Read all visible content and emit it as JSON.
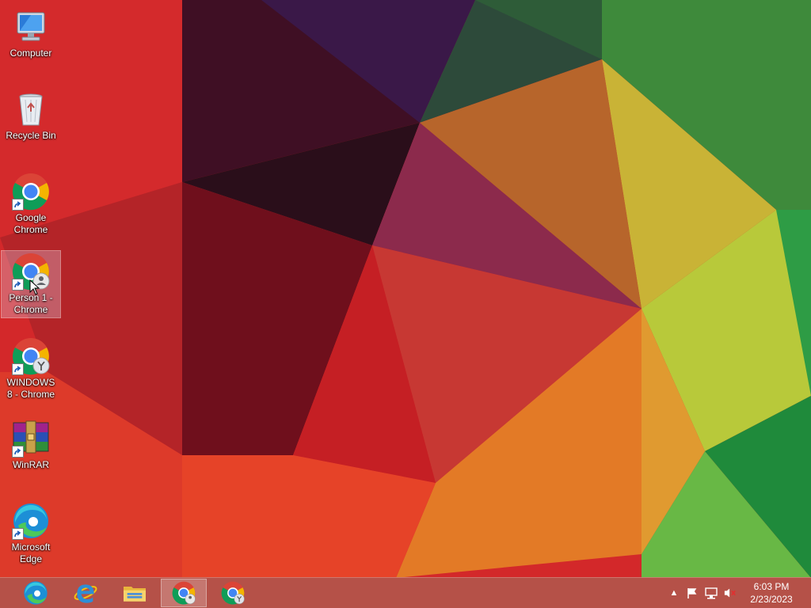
{
  "desktop": {
    "icons": [
      {
        "label": "Computer",
        "icon": "computer-icon"
      },
      {
        "label": "Recycle Bin",
        "icon": "recycle-bin-icon"
      },
      {
        "label": "Google Chrome",
        "icon": "chrome-icon"
      },
      {
        "label": "Person 1 - Chrome",
        "icon": "chrome-profile-icon",
        "selected": true
      },
      {
        "label": "WINDOWS 8 - Chrome",
        "icon": "chrome-profile-icon"
      },
      {
        "label": "WinRAR",
        "icon": "winrar-icon"
      },
      {
        "label": "Microsoft Edge",
        "icon": "edge-icon"
      }
    ]
  },
  "taskbar": {
    "pinned": [
      {
        "name": "Microsoft Edge",
        "icon": "edge-icon"
      },
      {
        "name": "Internet Explorer",
        "icon": "ie-icon"
      },
      {
        "name": "File Explorer",
        "icon": "folder-icon"
      },
      {
        "name": "Google Chrome",
        "icon": "chrome-icon",
        "active": true
      },
      {
        "name": "Chrome profile",
        "icon": "chrome-profile-icon"
      }
    ],
    "tray": {
      "icons": [
        "show-hidden-icon",
        "action-center-flag-icon",
        "network-icon",
        "volume-muted-icon"
      ]
    },
    "clock": {
      "time": "6:03 PM",
      "date": "2/23/2023"
    }
  },
  "colors": {
    "taskbar": "#b0564c",
    "selection": "#dcc8dc"
  }
}
